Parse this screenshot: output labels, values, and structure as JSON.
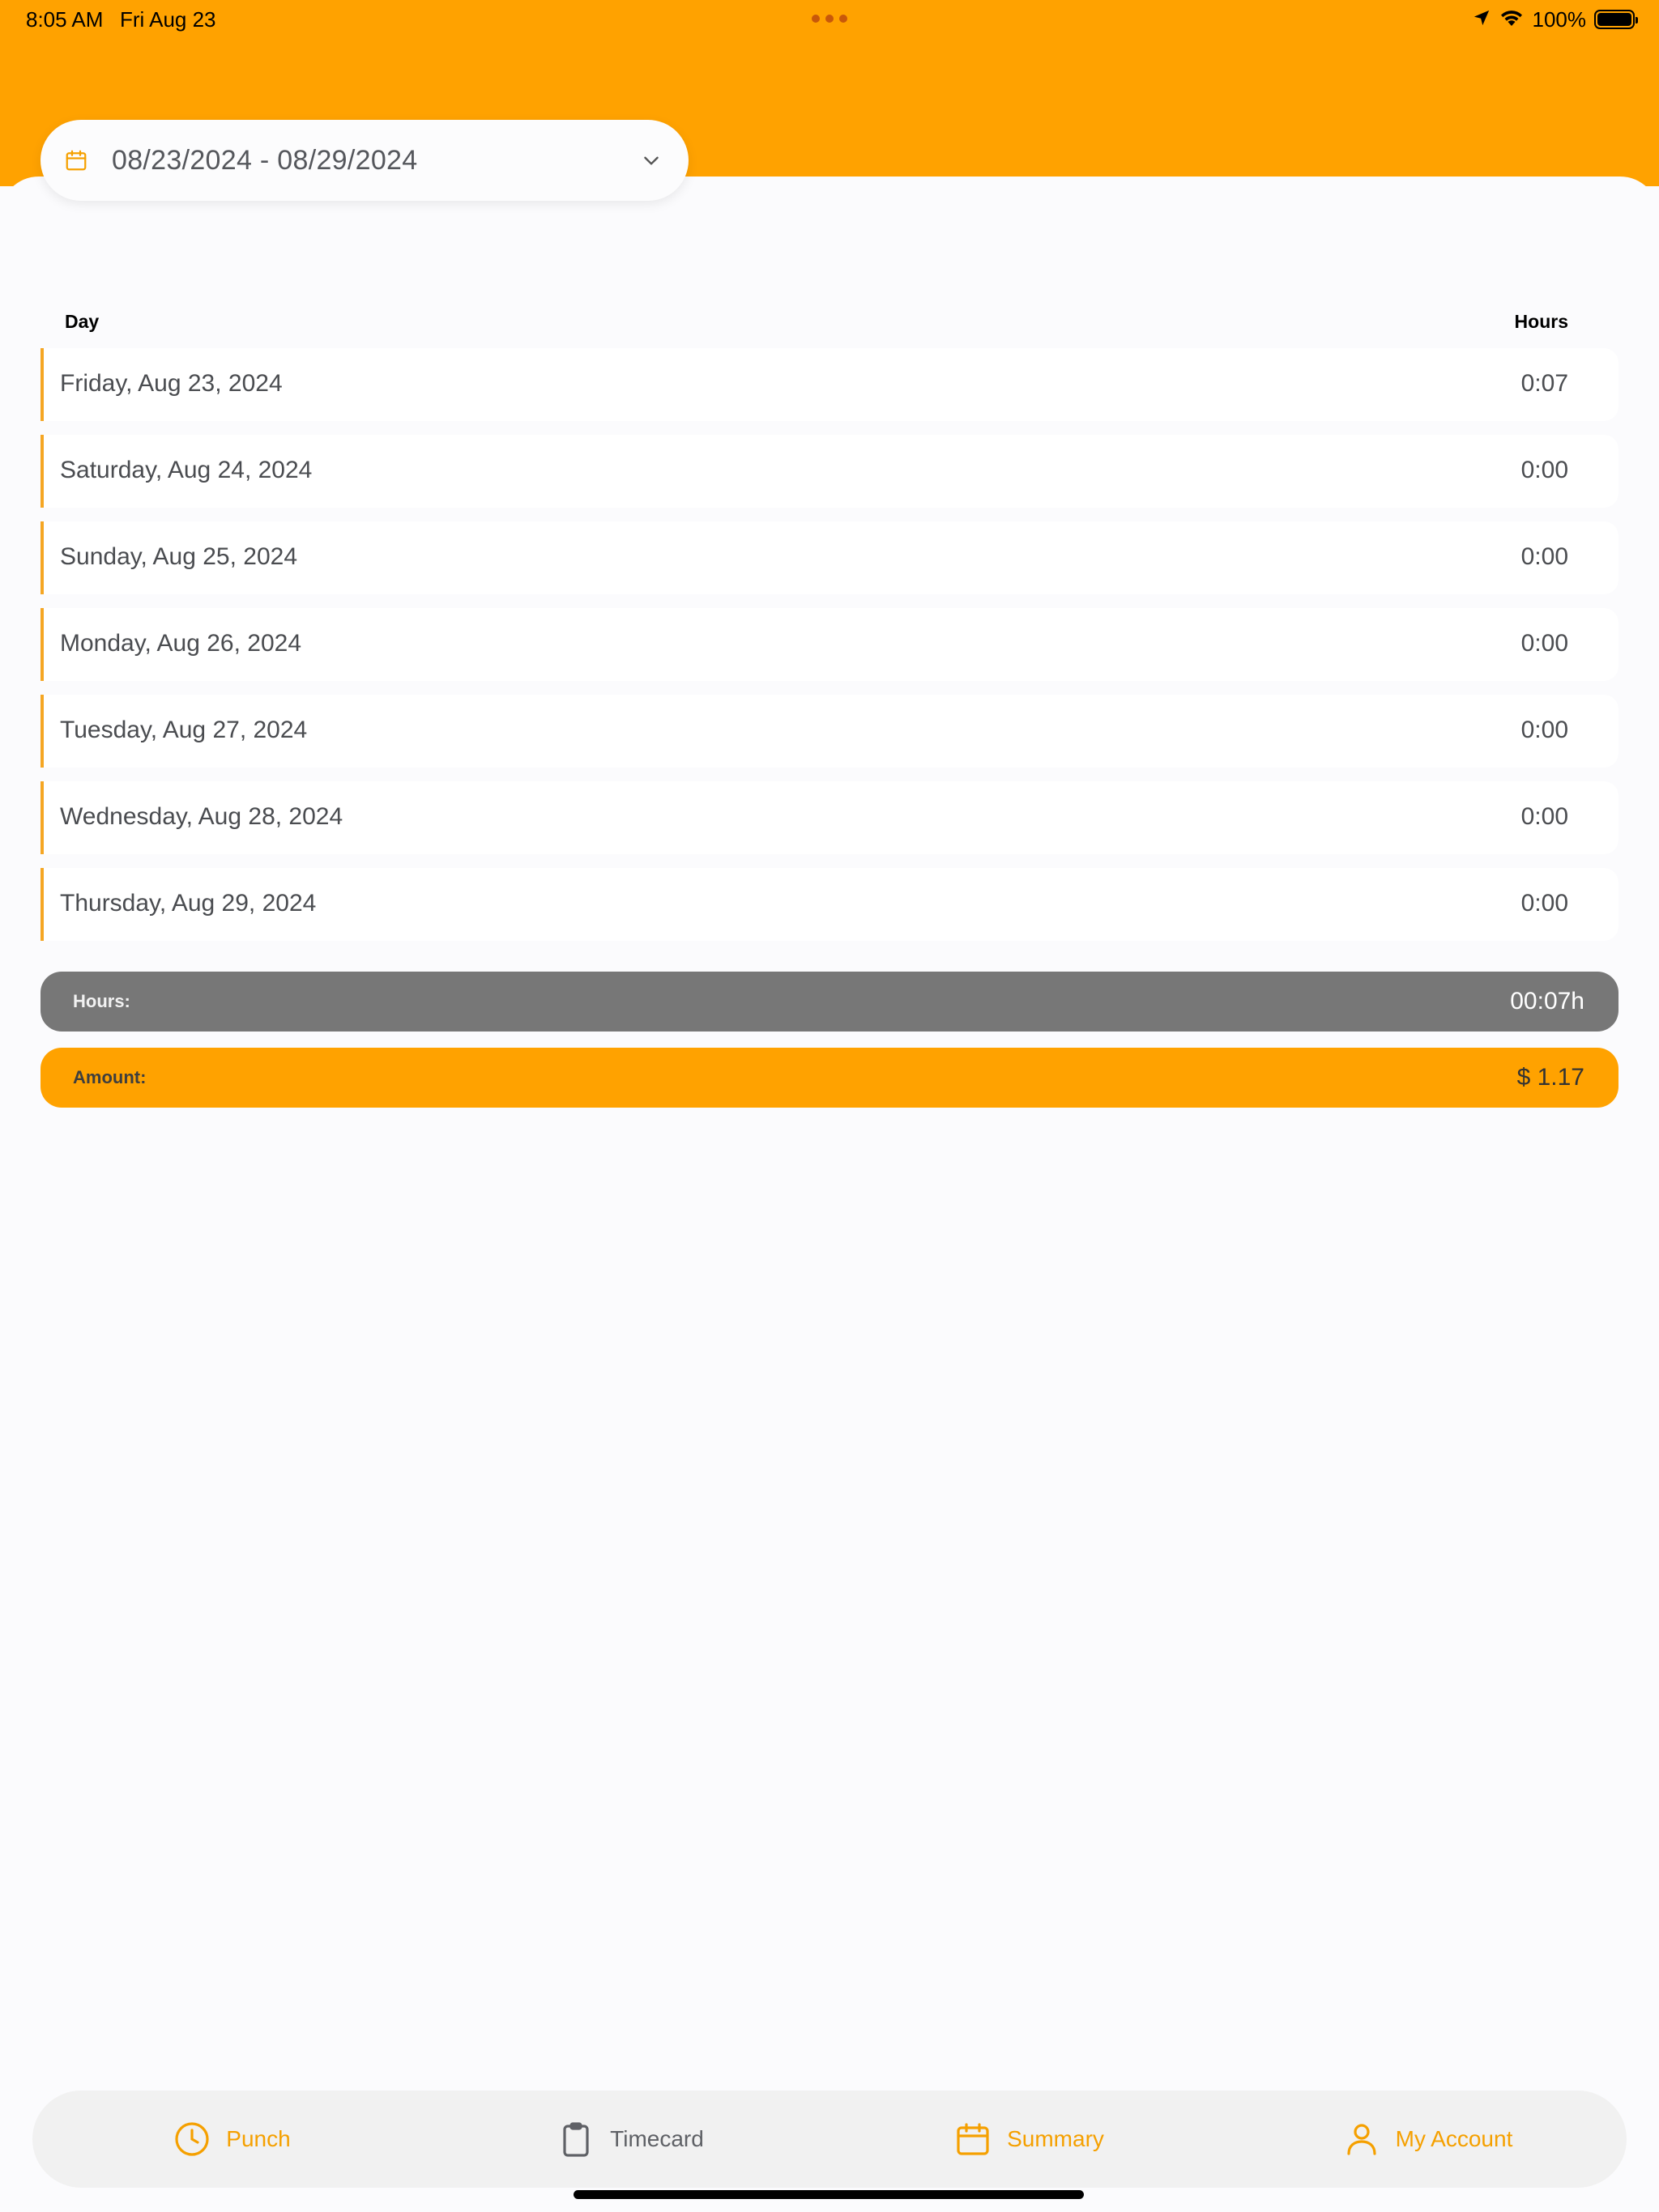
{
  "status_bar": {
    "time": "8:05 AM",
    "date": "Fri Aug 23",
    "battery": "100%",
    "icons": [
      "location-arrow-icon",
      "wifi-icon",
      "battery-icon"
    ]
  },
  "date_range": {
    "label": "08/23/2024 - 08/29/2024",
    "icon": "calendar-icon",
    "dropdown_icon": "chevron-down-icon"
  },
  "table": {
    "headers": {
      "day": "Day",
      "hours": "Hours"
    },
    "rows": [
      {
        "day": "Friday, Aug 23, 2024",
        "hours": "0:07"
      },
      {
        "day": "Saturday, Aug 24, 2024",
        "hours": "0:00"
      },
      {
        "day": "Sunday, Aug 25, 2024",
        "hours": "0:00"
      },
      {
        "day": "Monday, Aug 26, 2024",
        "hours": "0:00"
      },
      {
        "day": "Tuesday, Aug 27, 2024",
        "hours": "0:00"
      },
      {
        "day": "Wednesday, Aug 28, 2024",
        "hours": "0:00"
      },
      {
        "day": "Thursday, Aug 29, 2024",
        "hours": "0:00"
      }
    ]
  },
  "totals": {
    "hours_label": "Hours:",
    "hours_value": "00:07h",
    "amount_label": "Amount:",
    "amount_value": "$ 1.17"
  },
  "tabs": [
    {
      "label": "Punch",
      "icon": "clock-icon",
      "color": "#f5a000"
    },
    {
      "label": "Timecard",
      "icon": "clipboard-icon",
      "color": "#5f6166"
    },
    {
      "label": "Summary",
      "icon": "calendar-icon",
      "color": "#f5a000"
    },
    {
      "label": "My Account",
      "icon": "user-icon",
      "color": "#f5a000"
    }
  ],
  "colors": {
    "brand": "#ffa200",
    "row_accent": "#f5a623",
    "hours_bar": "#777777",
    "background": "#fbfbfd"
  }
}
